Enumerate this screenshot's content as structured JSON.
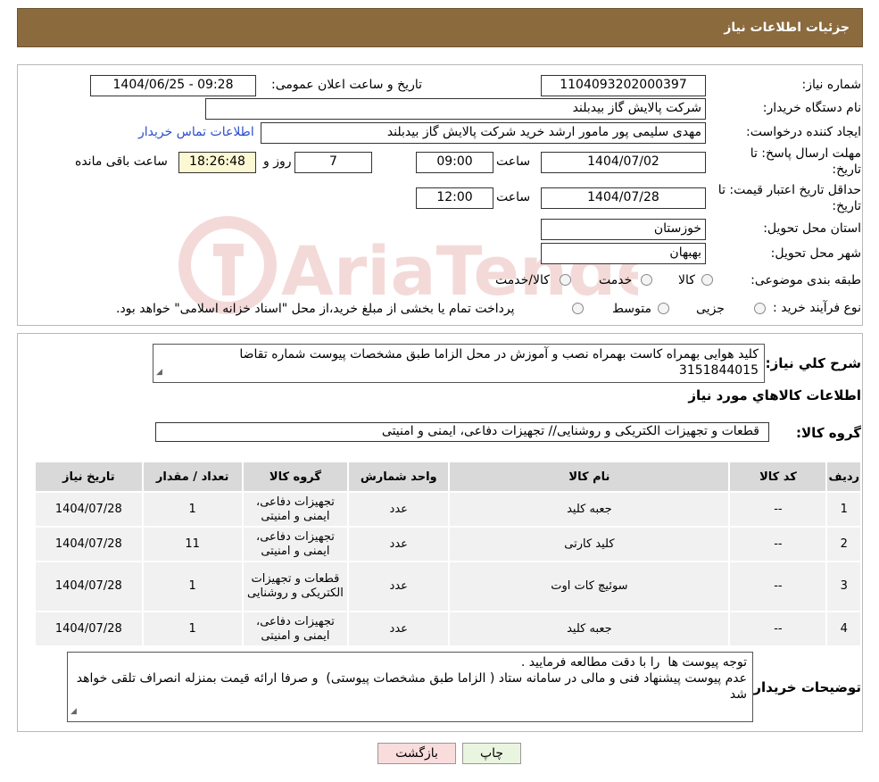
{
  "header": {
    "title": "جزئیات اطلاعات نیاز"
  },
  "form": {
    "need_number_label": "شماره نیاز:",
    "need_number": "1104093202000397",
    "announce_label": "تاریخ و ساعت اعلان عمومی:",
    "announce_value": "1404/06/25 - 09:28",
    "buyer_org_label": "نام دستگاه خریدار:",
    "buyer_org": "شرکت پالایش گاز بیدبلند",
    "requester_label": "ایجاد کننده درخواست:",
    "requester": "مهدی سلیمی پور مامور ارشد خرید شرکت پالایش گاز بیدبلند",
    "contact_link": "اطلاعات تماس خریدار",
    "deadline_label_1": "مهلت ارسال پاسخ: تا",
    "deadline_label_2": "تاریخ:",
    "deadline_date": "1404/07/02",
    "time_label": "ساعت",
    "deadline_time": "09:00",
    "days_value": "7",
    "days_label": "روز و",
    "remaining_time": "18:26:48",
    "remaining_label": "ساعت باقی مانده",
    "validity_label_1": "حداقل تاریخ اعتبار قیمت: تا",
    "validity_label_2": "تاریخ:",
    "validity_date": "1404/07/28",
    "validity_time": "12:00",
    "province_label": "استان محل تحویل:",
    "province": "خوزستان",
    "city_label": "شهر محل تحویل:",
    "city": "بهبهان",
    "category_label": "طبقه بندی موضوعی:",
    "category_options": [
      "کالا",
      "خدمت",
      "کالا/خدمت"
    ],
    "process_label": "نوع فرآیند خرید :",
    "process_options": [
      "جزیی",
      "متوسط"
    ],
    "process_note": "پرداخت تمام یا بخشی از مبلغ خرید،از محل \"اسناد خزانه اسلامی\" خواهد بود."
  },
  "summary": {
    "label": "شرح کلي نياز:",
    "text": "کلید هوایی بهمراه کاست بهمراه  نصب و آموزش  در محل الزاما طبق مشخصات پیوست شماره تقاضا 3151844015",
    "goods_info_title": "اطلاعات کالاهاي مورد نياز",
    "group_label": "گروه کالا:",
    "group_value": "قطعات و تجهیزات الکتریکی و روشنایی// تجهیزات دفاعی، ایمنی و امنیتی"
  },
  "table": {
    "headers": [
      "ردیف",
      "کد کالا",
      "نام کالا",
      "واحد شمارش",
      "گروه کالا",
      "تعداد / مقدار",
      "تاریخ نیاز"
    ],
    "rows": [
      {
        "idx": "1",
        "code": "--",
        "name": "جعبه کلید",
        "unit": "عدد",
        "group": "تجهیزات دفاعی، ایمنی و امنیتی",
        "qty": "1",
        "date": "1404/07/28"
      },
      {
        "idx": "2",
        "code": "--",
        "name": "کلید کارتی",
        "unit": "عدد",
        "group": "تجهیزات دفاعی، ایمنی و امنیتی",
        "qty": "11",
        "date": "1404/07/28"
      },
      {
        "idx": "3",
        "code": "--",
        "name": "سوئیچ کات اوت",
        "unit": "عدد",
        "group": "قطعات و تجهیزات الکتریکی و روشنایی",
        "qty": "1",
        "date": "1404/07/28"
      },
      {
        "idx": "4",
        "code": "--",
        "name": "جعبه کلید",
        "unit": "عدد",
        "group": "تجهیزات دفاعی، ایمنی و امنیتی",
        "qty": "1",
        "date": "1404/07/28"
      }
    ]
  },
  "notes": {
    "label": "توضیحات خریدار:",
    "text": "توجه پیوست ها  را با دقت مطالعه فرمایید .\nعدم پیوست پیشنهاد فنی و مالی در سامانه ستاد ( الزاما طبق مشخصات پیوستی)  و صرفا ارائه قیمت بمنزله انصراف تلقی خواهد شد"
  },
  "buttons": {
    "print": "چاپ",
    "back": "بازگشت"
  },
  "watermark": {
    "text": "AriaTender.neT",
    "color": "#c0392b"
  }
}
